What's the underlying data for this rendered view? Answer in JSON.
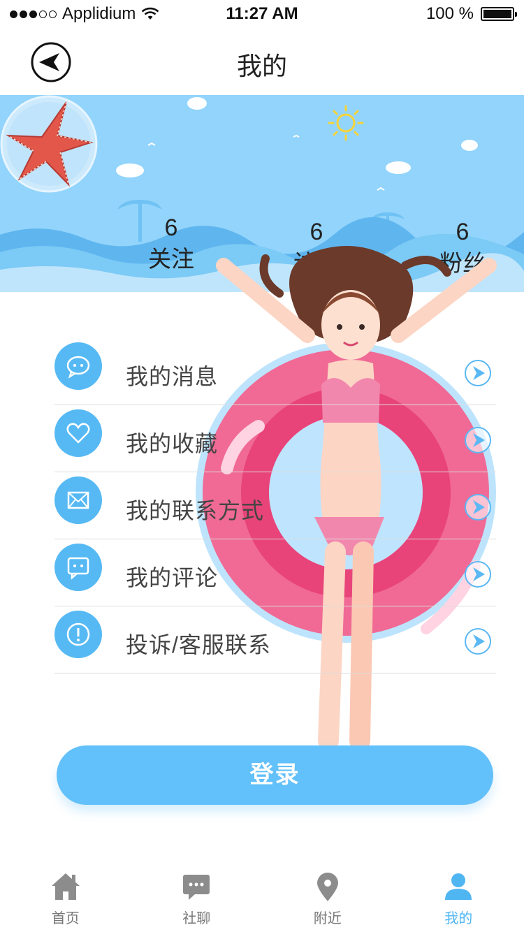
{
  "status_bar": {
    "carrier": "Applidium",
    "time": "11:27 AM",
    "battery_percent": "100 %",
    "battery_level": 1.0
  },
  "nav": {
    "title": "我的",
    "back_icon": "back-arrow-icon"
  },
  "stats": [
    {
      "value": "6",
      "label": "关注"
    },
    {
      "value": "6",
      "label": "访客"
    },
    {
      "value": "6",
      "label": "粉丝"
    }
  ],
  "menu": [
    {
      "label": "我的消息",
      "icon": "message-bubble-icon"
    },
    {
      "label": "我的收藏",
      "icon": "heart-icon"
    },
    {
      "label": "我的联系方式",
      "icon": "envelope-icon"
    },
    {
      "label": "我的评论",
      "icon": "comment-icon"
    },
    {
      "label": "投诉/客服联系",
      "icon": "exclamation-icon"
    }
  ],
  "login_label": "登录",
  "tabs": [
    {
      "label": "首页",
      "icon": "home-icon"
    },
    {
      "label": "社聊",
      "icon": "chat-icon"
    },
    {
      "label": "附近",
      "icon": "location-pin-icon"
    },
    {
      "label": "我的",
      "icon": "user-icon",
      "active": true
    }
  ],
  "colors": {
    "accent": "#62c0fa",
    "banner_sky": "#8fd2fb",
    "tab_active": "#4fb6f2"
  }
}
